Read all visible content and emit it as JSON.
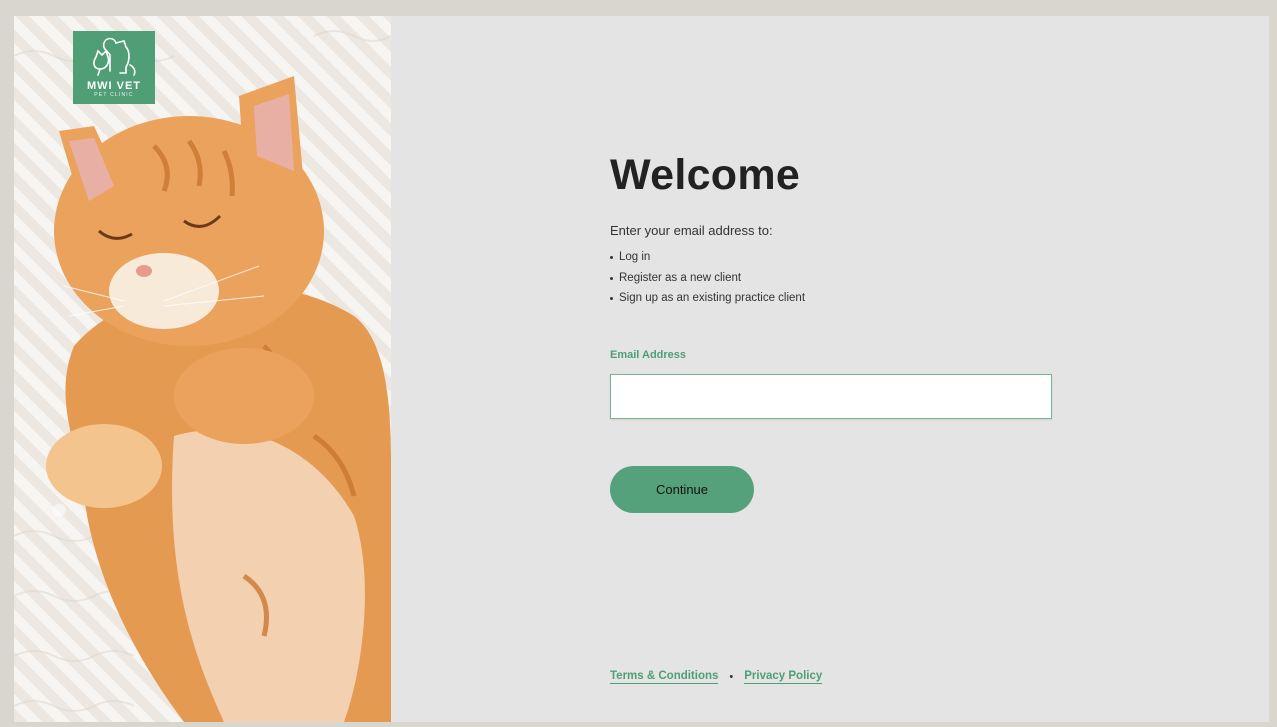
{
  "brand": {
    "logo_title": "MWI VET",
    "logo_subtitle": "PET CLINIC",
    "accent_color": "#4f9e76"
  },
  "photo": {
    "icon": "cat-photo"
  },
  "main": {
    "heading": "Welcome",
    "intro": "Enter your email address to:",
    "options": [
      "Log in",
      "Register as a new client",
      "Sign up as an existing practice client"
    ],
    "email_label": "Email Address",
    "email_value": "",
    "email_placeholder": "",
    "continue_label": "Continue"
  },
  "footer": {
    "terms_label": "Terms & Conditions",
    "separator": "•",
    "privacy_label": "Privacy Policy"
  }
}
